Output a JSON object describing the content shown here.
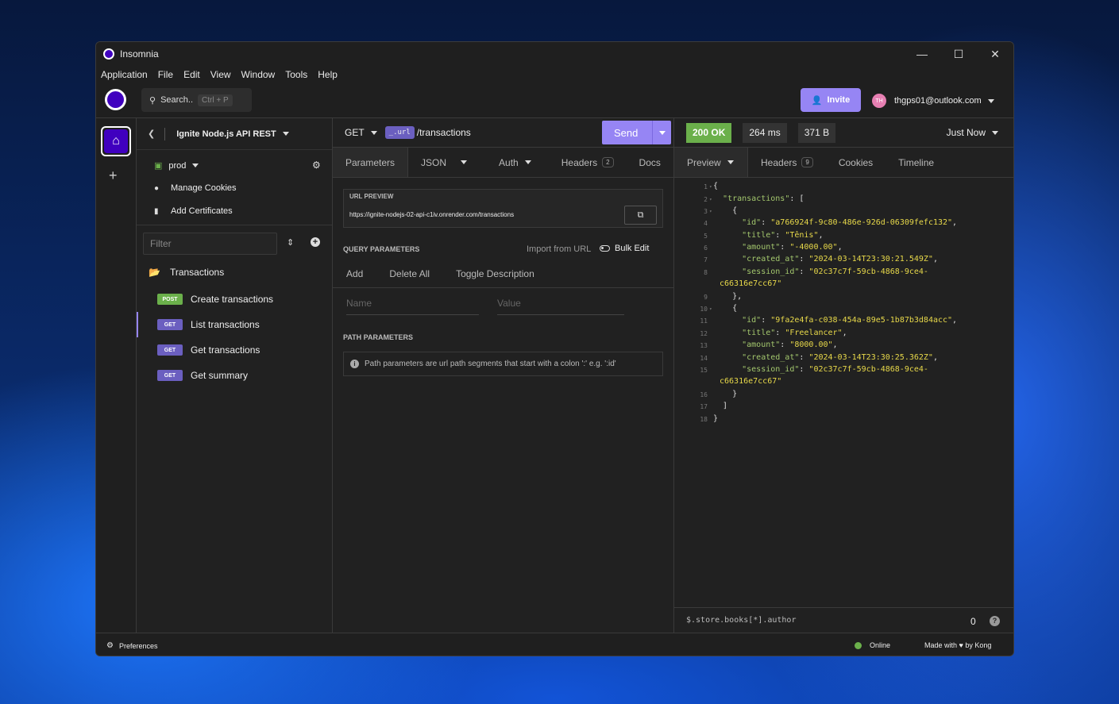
{
  "window": {
    "title": "Insomnia",
    "minimize": "—",
    "maximize": "☐",
    "close": "✕"
  },
  "menu": [
    "Application",
    "File",
    "Edit",
    "View",
    "Window",
    "Tools",
    "Help"
  ],
  "topbar": {
    "search_label": "Search..",
    "search_shortcut": "Ctrl + P",
    "invite_label": "Invite",
    "avatar_initials": "TH",
    "account_email": "thgps01@outlook.com"
  },
  "sidebar": {
    "project_name": "Ignite Node.js API REST",
    "environment": "prod",
    "links": {
      "cookies": "Manage Cookies",
      "certificates": "Add Certificates"
    },
    "filter_placeholder": "Filter",
    "folder": "Transactions",
    "requests": [
      {
        "method": "POST",
        "name": "Create transactions"
      },
      {
        "method": "GET",
        "name": "List transactions"
      },
      {
        "method": "GET",
        "name": "Get transactions"
      },
      {
        "method": "GET",
        "name": "Get summary"
      }
    ]
  },
  "request": {
    "method": "GET",
    "url_tag": "_.url",
    "url_path": "/transactions",
    "send_label": "Send",
    "tabs": {
      "parameters": "Parameters",
      "json": "JSON",
      "auth": "Auth",
      "headers": "Headers",
      "headers_count": "2",
      "docs": "Docs"
    },
    "url_preview_label": "URL PREVIEW",
    "url_preview_value": "https://ignite-nodejs-02-api-c1iv.onrender.com/transactions",
    "query_label": "QUERY PARAMETERS",
    "import_label": "Import from URL",
    "bulk_edit_label": "Bulk Edit",
    "query_actions": {
      "add": "Add",
      "delete_all": "Delete All",
      "toggle_desc": "Toggle Description"
    },
    "name_placeholder": "Name",
    "value_placeholder": "Value",
    "path_label": "PATH PARAMETERS",
    "path_info": "Path parameters are url path segments that start with a colon ':' e.g. ':id'"
  },
  "response": {
    "status": "200 OK",
    "time": "264 ms",
    "size": "371 B",
    "when": "Just Now",
    "tabs": {
      "preview": "Preview",
      "headers": "Headers",
      "headers_count": "9",
      "cookies": "Cookies",
      "timeline": "Timeline"
    },
    "code": {
      "l1": "{",
      "l2_key": "\"transactions\"",
      "l2_rest": ": [",
      "l3": "{",
      "l4_key": "\"id\"",
      "l4_val": "\"a766924f-9c80-486e-926d-06309fefc132\"",
      "l5_key": "\"title\"",
      "l5_val": "\"Tênis\"",
      "l6_key": "\"amount\"",
      "l6_val": "\"-4000.00\"",
      "l7_key": "\"created_at\"",
      "l7_val": "\"2024-03-14T23:30:21.549Z\"",
      "l8_key": "\"session_id\"",
      "l8_val": "\"02c37c7f-59cb-4868-9ce4-",
      "l8_wrap": "c66316e7cc67\"",
      "l9": "},",
      "l10": "{",
      "l11_key": "\"id\"",
      "l11_val": "\"9fa2e4fa-c038-454a-89e5-1b87b3d84acc\"",
      "l12_key": "\"title\"",
      "l12_val": "\"Freelancer\"",
      "l13_key": "\"amount\"",
      "l13_val": "\"8000.00\"",
      "l14_key": "\"created_at\"",
      "l14_val": "\"2024-03-14T23:30:25.362Z\"",
      "l15_key": "\"session_id\"",
      "l15_val": "\"02c37c7f-59cb-4868-9ce4-",
      "l15_wrap": "c66316e7cc67\"",
      "l16": "}",
      "l17": "]",
      "l18": "}"
    },
    "jsonpath_placeholder": "$.store.books[*].author",
    "jsonpath_count": "0",
    "help": "?"
  },
  "footer": {
    "preferences": "Preferences",
    "status": "Online",
    "made_with": "Made with ♥ by Kong"
  }
}
